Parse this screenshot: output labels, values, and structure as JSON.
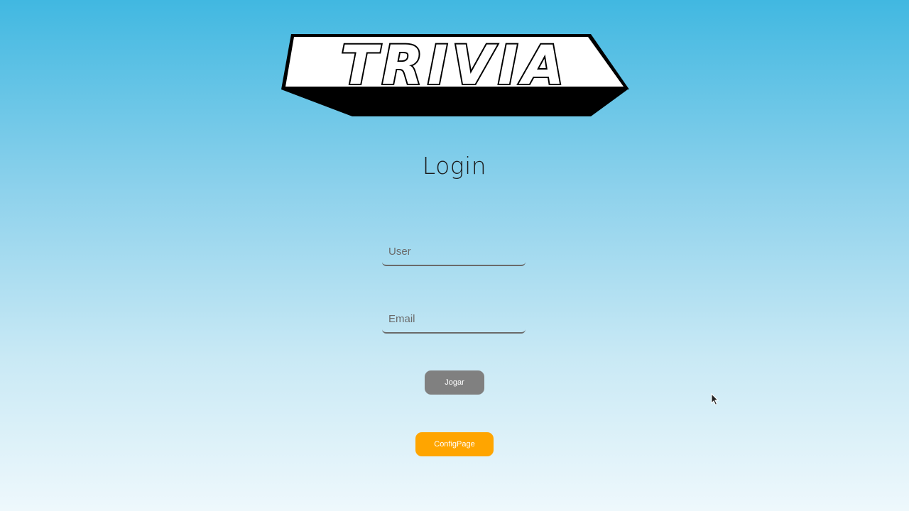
{
  "logo": {
    "text": "TRIVIA"
  },
  "login": {
    "title": "Login",
    "user_placeholder": "User",
    "email_placeholder": "Email",
    "play_button": "Jogar",
    "config_button": "ConfigPage"
  },
  "colors": {
    "background_top": "#41b8e1",
    "background_bottom": "#eef8fc",
    "play_button": "#808080",
    "config_button": "#ffa500"
  },
  "icons": {
    "pointer": "mouse-pointer-icon"
  }
}
